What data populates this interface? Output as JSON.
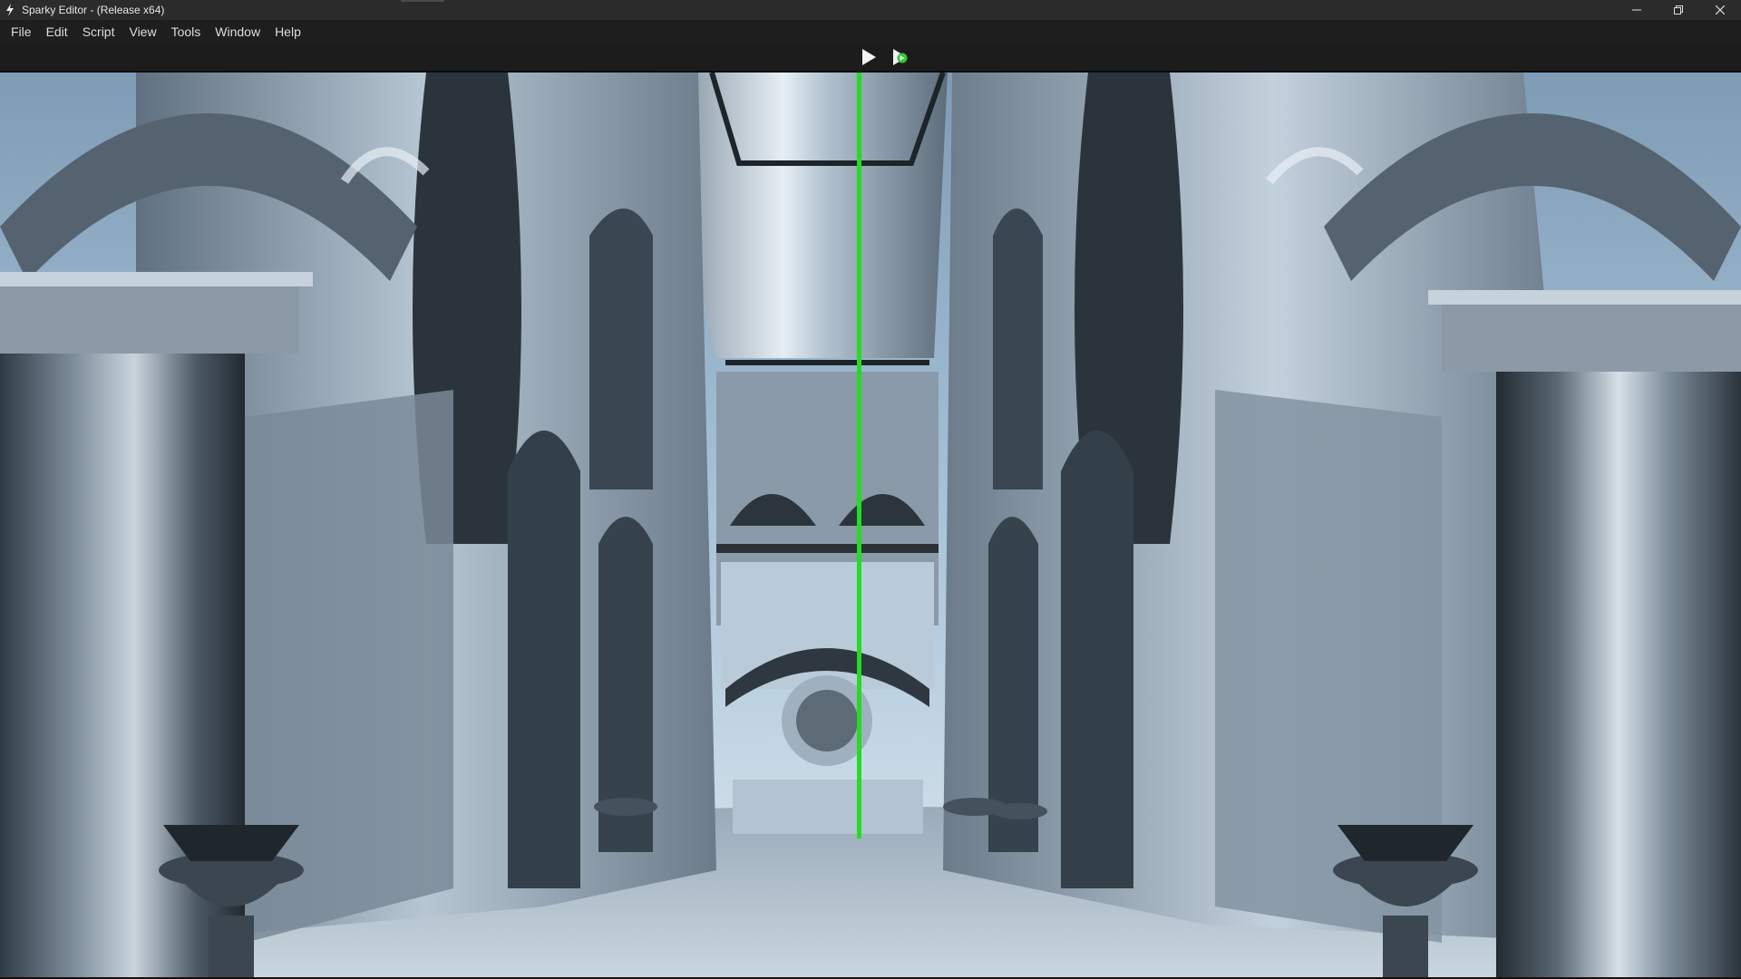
{
  "window": {
    "title": "Sparky Editor - (Release x64)",
    "controls": [
      "minimize",
      "restore",
      "close"
    ]
  },
  "menu": {
    "file": "File",
    "edit": "Edit",
    "script": "Script",
    "view": "View",
    "tools": "Tools",
    "window": "Window",
    "help": "Help"
  },
  "toolbar": {
    "play_icon": "play-icon",
    "play_simulate_icon": "play-simulate-icon"
  },
  "viewport": {
    "scene": "sponza-atrium",
    "split_line_color": "#22dd22"
  },
  "colors": {
    "titlebar": "#2b2b2b",
    "menubar": "#1e1e1e",
    "accent_green": "#33cc33"
  }
}
